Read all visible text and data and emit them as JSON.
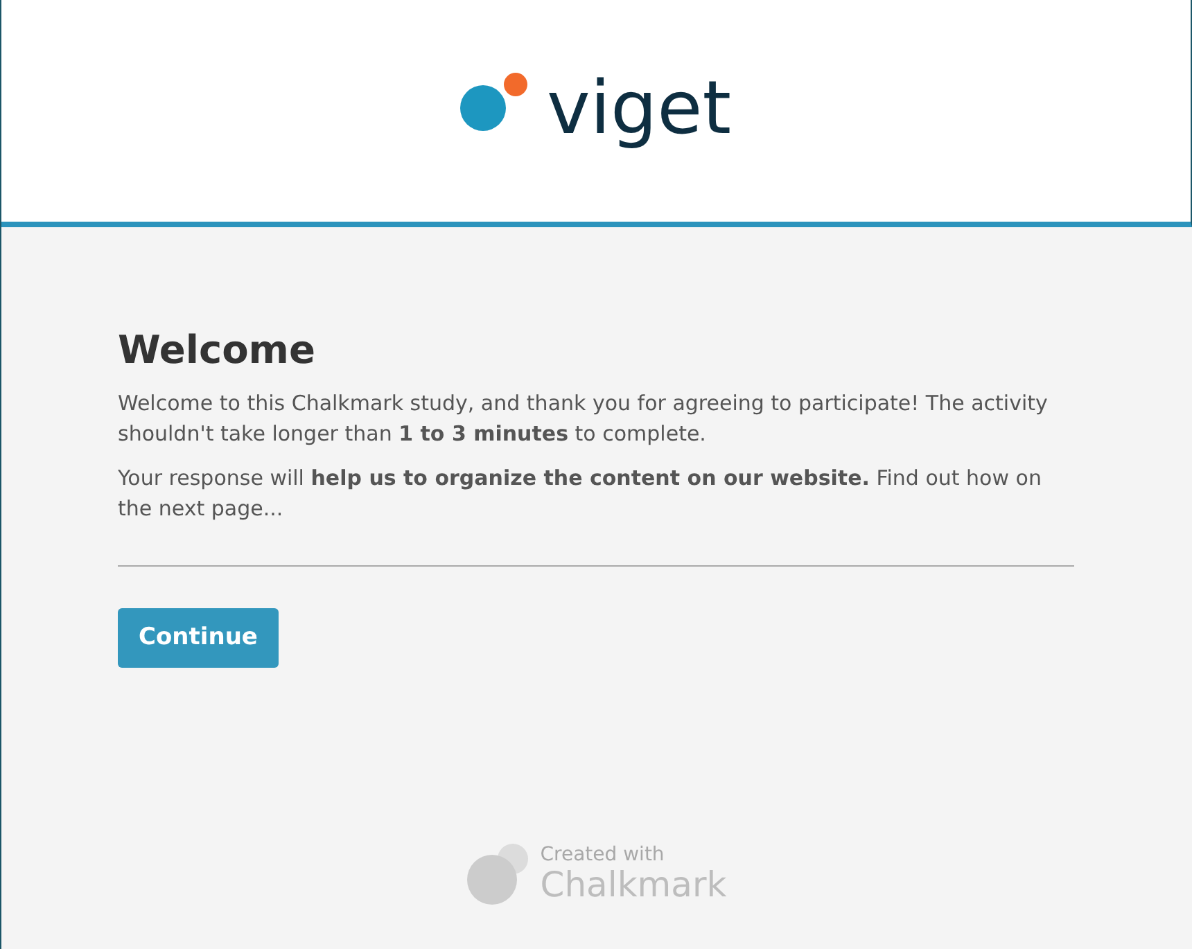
{
  "header": {
    "logo_text": "viget"
  },
  "content": {
    "title": "Welcome",
    "paragraphs": [
      "Welcome to this Chalkmark study, and thank you for agreeing to participate! The activity shouldn't take longer than **1 to 3 minutes** to complete.",
      "Your response will **help us to organize the content on our website.** Find out how on the next page..."
    ],
    "button": "Continue"
  },
  "footer": {
    "caption": "Created with",
    "brand": "Chalkmark"
  }
}
